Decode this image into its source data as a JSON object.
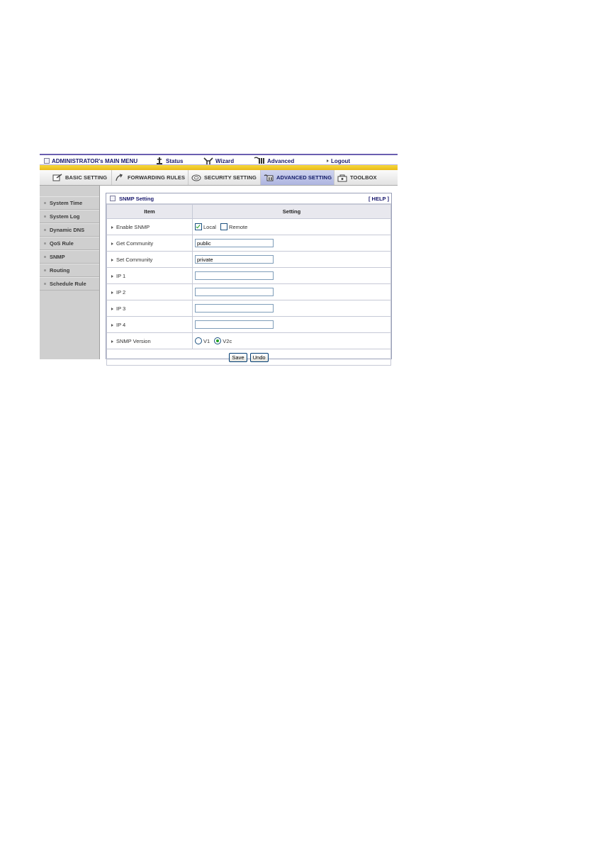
{
  "topbar": {
    "title": "ADMINISTRATOR's MAIN MENU",
    "status": "Status",
    "wizard": "Wizard",
    "advanced": "Advanced",
    "logout": "Logout"
  },
  "tabs": [
    {
      "label": "BASIC SETTING",
      "icon": "basic-setting-icon"
    },
    {
      "label": "FORWARDING RULES",
      "icon": "forwarding-rules-icon"
    },
    {
      "label": "SECURITY SETTING",
      "icon": "security-setting-icon"
    },
    {
      "label": "ADVANCED SETTING",
      "icon": "advanced-setting-icon",
      "active": true
    },
    {
      "label": "TOOLBOX",
      "icon": "toolbox-icon"
    }
  ],
  "sidebar": {
    "items": [
      "System Time",
      "System Log",
      "Dynamic DNS",
      "QoS Rule",
      "SNMP",
      "Routing",
      "Schedule Rule"
    ]
  },
  "panel": {
    "title": "SNMP Setting",
    "help": "[ HELP ]",
    "col_item": "Item",
    "col_setting": "Setting",
    "rows": {
      "enable": {
        "label": "Enable SNMP",
        "local": "Local",
        "remote": "Remote",
        "local_checked": true,
        "remote_checked": false
      },
      "get": {
        "label": "Get Community",
        "value": "public"
      },
      "set": {
        "label": "Set Community",
        "value": "private"
      },
      "ip1": {
        "label": "IP 1",
        "value": ""
      },
      "ip2": {
        "label": "IP 2",
        "value": ""
      },
      "ip3": {
        "label": "IP 3",
        "value": ""
      },
      "ip4": {
        "label": "IP 4",
        "value": ""
      },
      "version": {
        "label": "SNMP Version",
        "v1": "V1",
        "v2c": "V2c",
        "selected": "V2c"
      }
    },
    "save": "Save",
    "undo": "Undo"
  },
  "colors": {
    "accent_purple": "#6a5fb0",
    "stripe_yellow": "#f6da3c",
    "active_tab": "#aeb5e0",
    "sidebar_bg": "#cfcfcf"
  }
}
